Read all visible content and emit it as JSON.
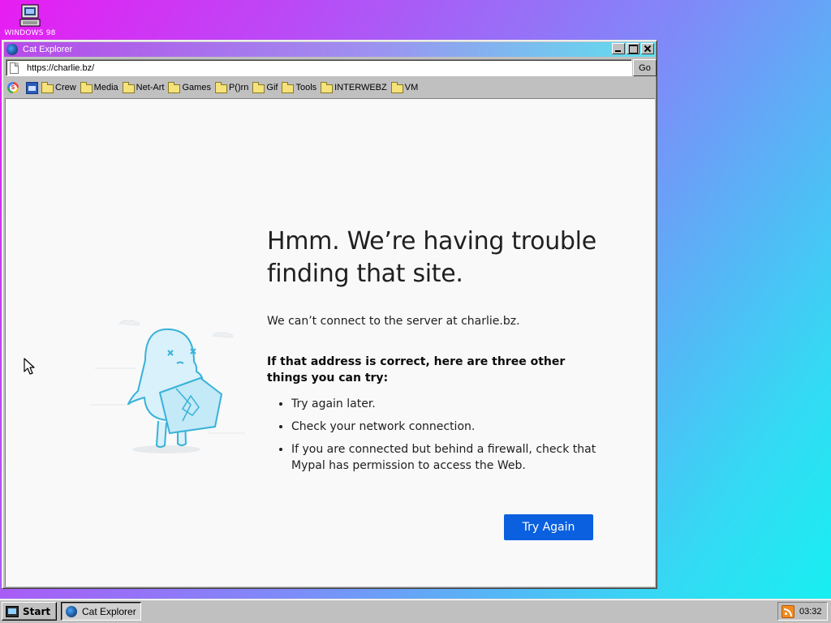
{
  "desktop": {
    "icon_label": "WINDOWS 98"
  },
  "window": {
    "title": "Cat Explorer",
    "address": "https://charlie.bz/",
    "go_label": "Go"
  },
  "bookmarks": [
    "Crew",
    "Media",
    "Net-Art",
    "Games",
    "P()rn",
    "Gif",
    "Tools",
    "INTERWEBZ",
    "VM"
  ],
  "error_page": {
    "heading": "Hmm. We’re having trouble finding that site.",
    "description": "We can’t connect to the server at charlie.bz.",
    "subheading": "If that address is correct, here are three other things you can try:",
    "suggestions": [
      "Try again later.",
      "Check your network connection.",
      "If you are connected but behind a firewall, check that Mypal has permission to access the Web."
    ],
    "button_label": "Try Again",
    "accent_color": "#0a60df"
  },
  "taskbar": {
    "start_label": "Start",
    "task_label": "Cat Explorer",
    "clock": "03:32"
  }
}
